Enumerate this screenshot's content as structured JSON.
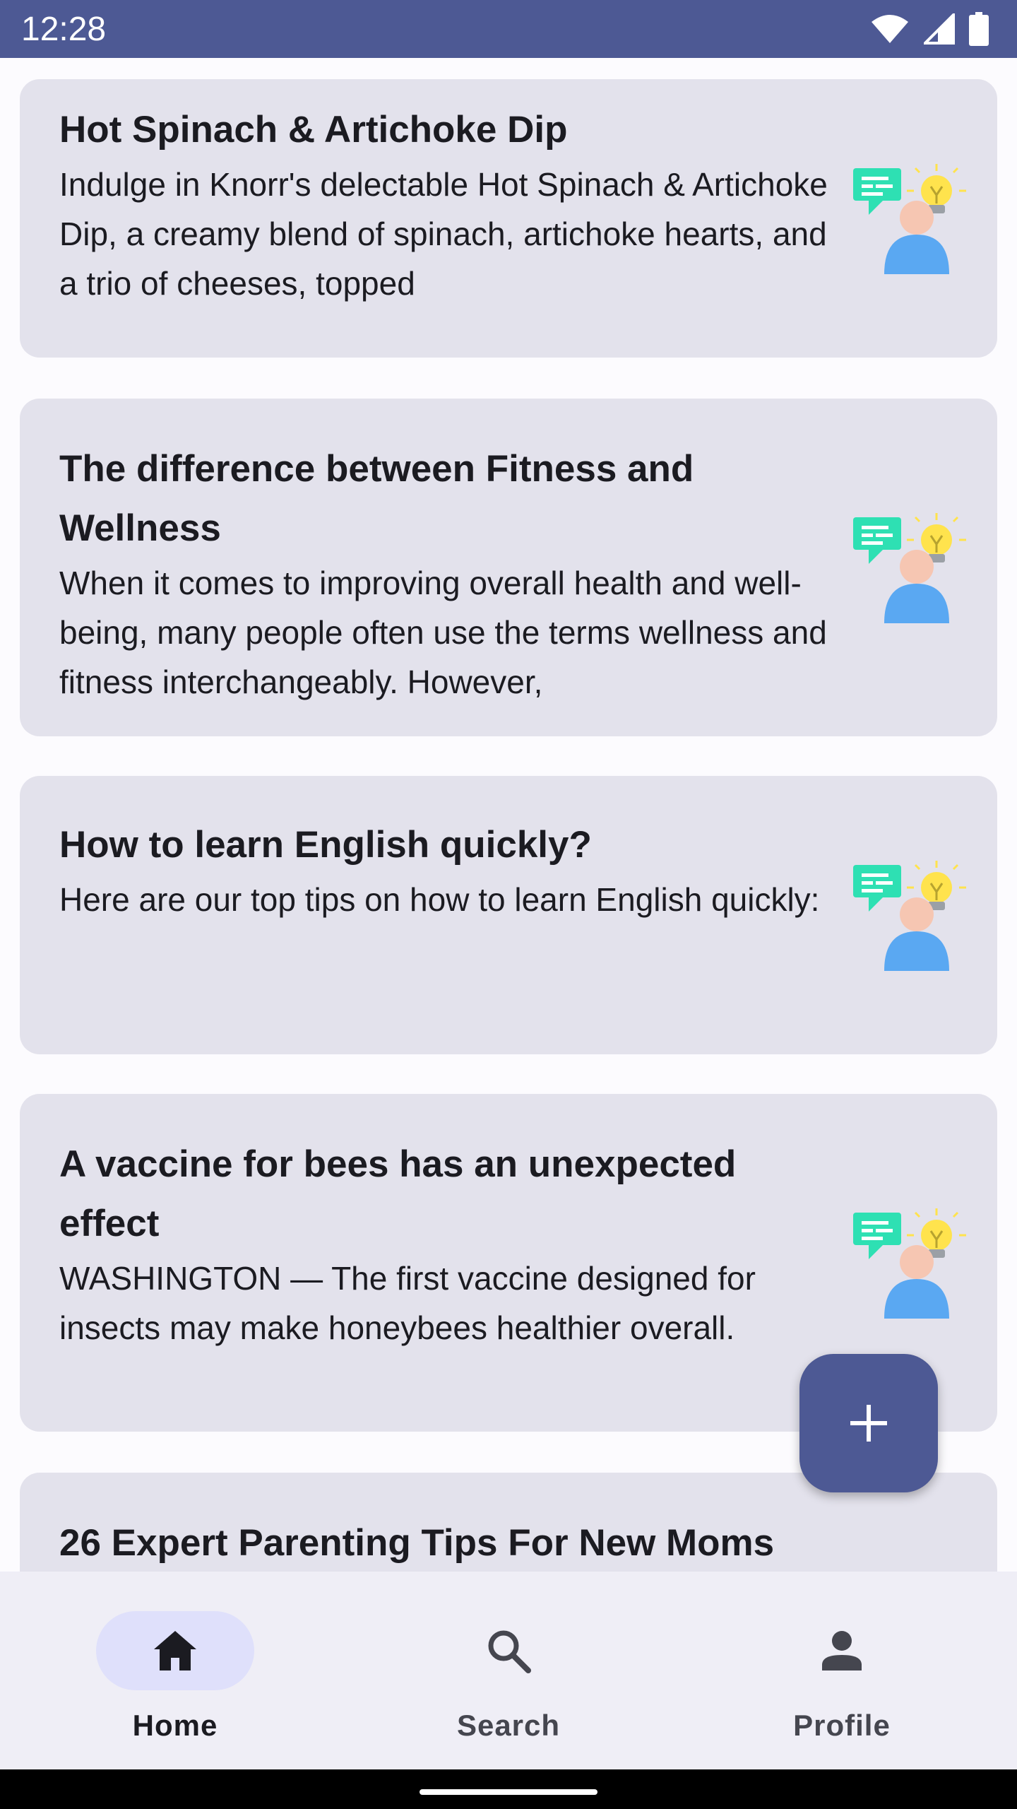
{
  "status_bar": {
    "time": "12:28",
    "icons": [
      "wifi-icon",
      "signal-icon",
      "battery-icon"
    ],
    "background": "#4d5994"
  },
  "cards": [
    {
      "title": "Hot Spinach & Artichoke Dip",
      "body": "Indulge in Knorr's delectable Hot Spinach & Artichoke Dip, a creamy blend of spinach, artichoke hearts, and a trio of cheeses, topped",
      "illustration": "idea-person-icon"
    },
    {
      "title": "The difference between Fitness and Wellness",
      "body": "When it comes to improving overall health and well-being, many people often use the terms wellness and fitness interchangeably. However,",
      "illustration": "idea-person-icon"
    },
    {
      "title": "How to learn English quickly?",
      "body": "Here are our top tips on how to learn English quickly:",
      "illustration": "idea-person-icon"
    },
    {
      "title": "A vaccine for bees has an unexpected effect",
      "body": "WASHINGTON — The first vaccine designed for insects may make honeybees healthier overall.",
      "illustration": "idea-person-icon"
    },
    {
      "title": "26 Expert Parenting Tips For New Moms",
      "body": "",
      "illustration": "idea-person-icon"
    }
  ],
  "fab": {
    "icon": "plus-icon"
  },
  "bottom_nav": {
    "items": [
      {
        "label": "Home",
        "icon": "home-icon",
        "active": true
      },
      {
        "label": "Search",
        "icon": "search-icon",
        "active": false
      },
      {
        "label": "Profile",
        "icon": "person-icon",
        "active": false
      }
    ]
  },
  "colors": {
    "primary": "#4d5994",
    "card_background": "#e3e2ec",
    "nav_background": "#efeef6",
    "active_indicator": "#dfe0fb"
  }
}
